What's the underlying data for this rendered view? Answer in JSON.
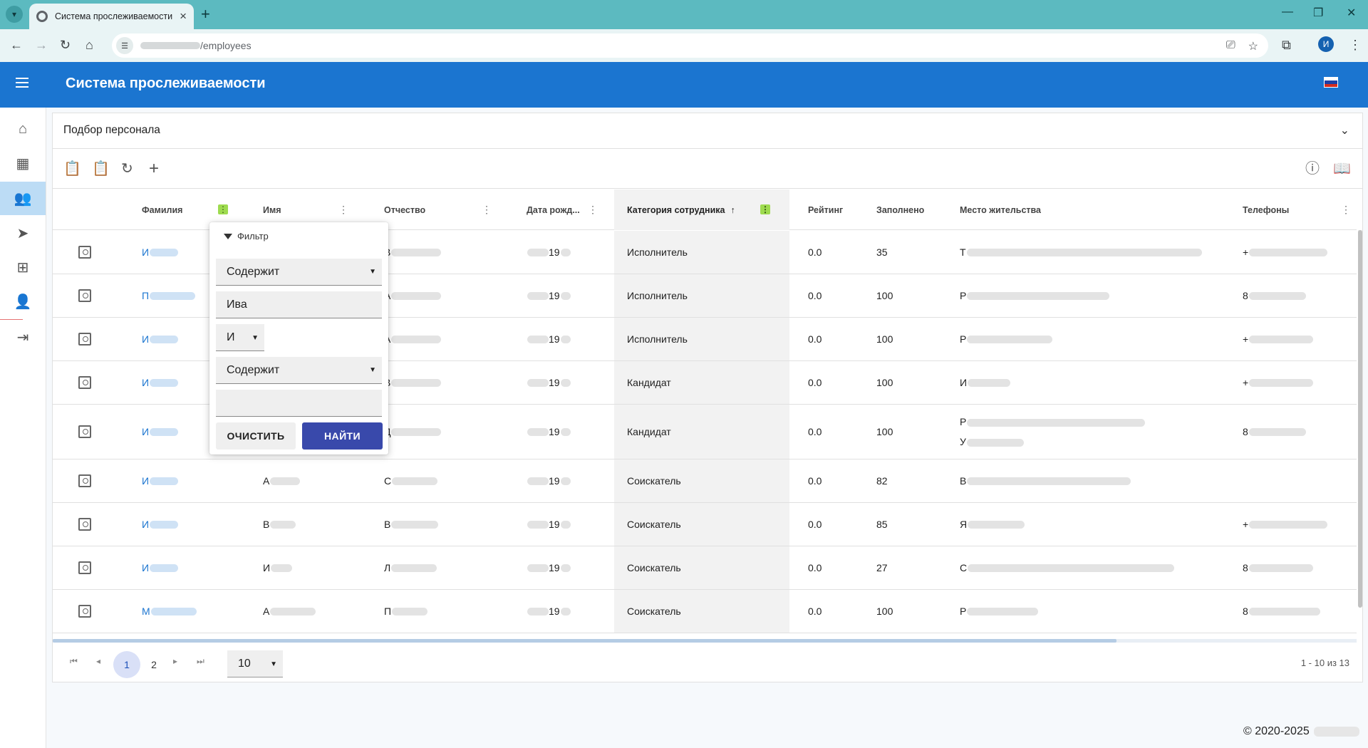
{
  "browser": {
    "tab_title": "Система прослеживаемости",
    "url_path": "/employees",
    "profile_initial": "И"
  },
  "app": {
    "title": "Система прослеживаемости",
    "header_color": "#1b75d0",
    "language_flag": "ru-flag"
  },
  "sidenav": {
    "items": [
      {
        "name": "home-icon",
        "active": false
      },
      {
        "name": "building-icon",
        "active": false
      },
      {
        "name": "people-icon",
        "active": true
      },
      {
        "name": "send-icon",
        "active": false
      },
      {
        "name": "hierarchy-icon",
        "active": false
      },
      {
        "name": "person-icon",
        "active": false
      },
      {
        "name": "login-icon",
        "active": false
      }
    ]
  },
  "panel": {
    "title": "Подбор персонала"
  },
  "toolbar": {
    "buttons": [
      "clipboard-icon",
      "clipboard-list-icon",
      "refresh-icon",
      "add-icon"
    ],
    "right_buttons": [
      "info-icon",
      "book-icon"
    ]
  },
  "table": {
    "columns": {
      "lastname": "Фамилия",
      "firstname": "Имя",
      "patronymic": "Отчество",
      "birthdate": "Дата рожд...",
      "category": "Категория сотрудника",
      "rating": "Рейтинг",
      "filled": "Заполнено",
      "residence": "Место жительства",
      "phones": "Телефоны"
    },
    "sort_indicator": "↑",
    "rows": [
      {
        "lastname": "И",
        "firstname": "",
        "patronymic": "В",
        "birth_mid": "19",
        "category": "Исполнитель",
        "rating": "0.0",
        "filled": "35",
        "residence": "Т",
        "phone": "+"
      },
      {
        "lastname": "П",
        "firstname": "",
        "patronymic": "А",
        "birth_mid": "19",
        "category": "Исполнитель",
        "rating": "0.0",
        "filled": "100",
        "residence": "Р",
        "phone": "8"
      },
      {
        "lastname": "И",
        "firstname": "",
        "patronymic": "А",
        "birth_mid": "19",
        "category": "Исполнитель",
        "rating": "0.0",
        "filled": "100",
        "residence": "Р",
        "phone": "+"
      },
      {
        "lastname": "И",
        "firstname": "",
        "patronymic": "В",
        "birth_mid": "19",
        "category": "Кандидат",
        "rating": "0.0",
        "filled": "100",
        "residence": "И",
        "phone": "+"
      },
      {
        "lastname": "И",
        "firstname": "",
        "patronymic": "Д",
        "birth_mid": "19",
        "category": "Кандидат",
        "rating": "0.0",
        "filled": "100",
        "residence": "Р",
        "residence2": "У",
        "phone": "8"
      },
      {
        "lastname": "И",
        "firstname": "А",
        "patronymic": "С",
        "birth_mid": "19",
        "category": "Соискатель",
        "rating": "0.0",
        "filled": "82",
        "residence": "В",
        "phone": ""
      },
      {
        "lastname": "И",
        "firstname": "В",
        "patronymic": "В",
        "birth_mid": "19",
        "category": "Соискатель",
        "rating": "0.0",
        "filled": "85",
        "residence": "Я",
        "phone": "+"
      },
      {
        "lastname": "И",
        "firstname": "И",
        "patronymic": "Л",
        "birth_mid": "19",
        "category": "Соискатель",
        "rating": "0.0",
        "filled": "27",
        "residence": "С",
        "phone": "8"
      },
      {
        "lastname": "М",
        "firstname": "А",
        "patronymic": "П",
        "birth_mid": "19",
        "category": "Соискатель",
        "rating": "0.0",
        "filled": "100",
        "residence": "Р",
        "phone": "8"
      }
    ]
  },
  "pager": {
    "pages": [
      "1",
      "2"
    ],
    "current_page": "1",
    "page_size": "10",
    "info": "1 - 10 из 13"
  },
  "filter_popup": {
    "title": "Фильтр",
    "condition1": "Содержит",
    "value1": "Ива",
    "logic_operator": "И",
    "condition2": "Содержит",
    "value2": "",
    "clear_label": "ОЧИСТИТЬ",
    "find_label": "НАЙТИ"
  },
  "footer": {
    "copyright": "© 2020-2025"
  }
}
